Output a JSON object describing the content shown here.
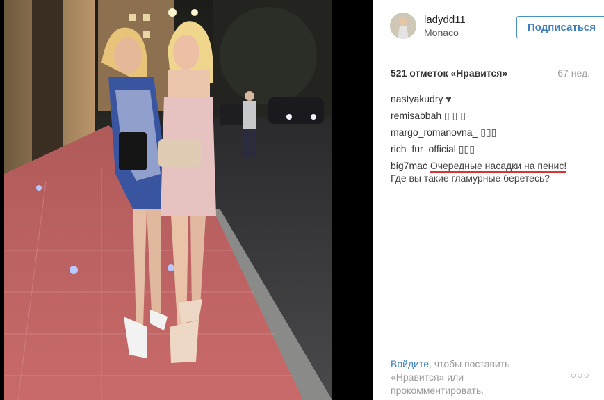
{
  "post": {
    "username": "ladydd11",
    "location": "Monaco",
    "follow_label": "Подписаться",
    "likes": "521 отметок «Нравится»",
    "age": "67 нед.",
    "comments": [
      {
        "user": "nastyakudry",
        "text": "♥"
      },
      {
        "user": "remisabbah",
        "text": "▯ ▯ ▯"
      },
      {
        "user": "margo_romanovna_",
        "text": "▯▯▯"
      },
      {
        "user": "rich_fur_official",
        "text": "▯▯▯"
      },
      {
        "user": "big7mac",
        "text": "Очередные насадки на пенис!",
        "text2": "Где вы такие гламурные беретесь?"
      }
    ],
    "login_link": "Войдите",
    "login_rest": ", чтобы поставить «Нравится» или прокомментировать.",
    "more_label": "○○○"
  },
  "colors": {
    "accent": "#3d7fbd",
    "underline": "#dd3333"
  }
}
